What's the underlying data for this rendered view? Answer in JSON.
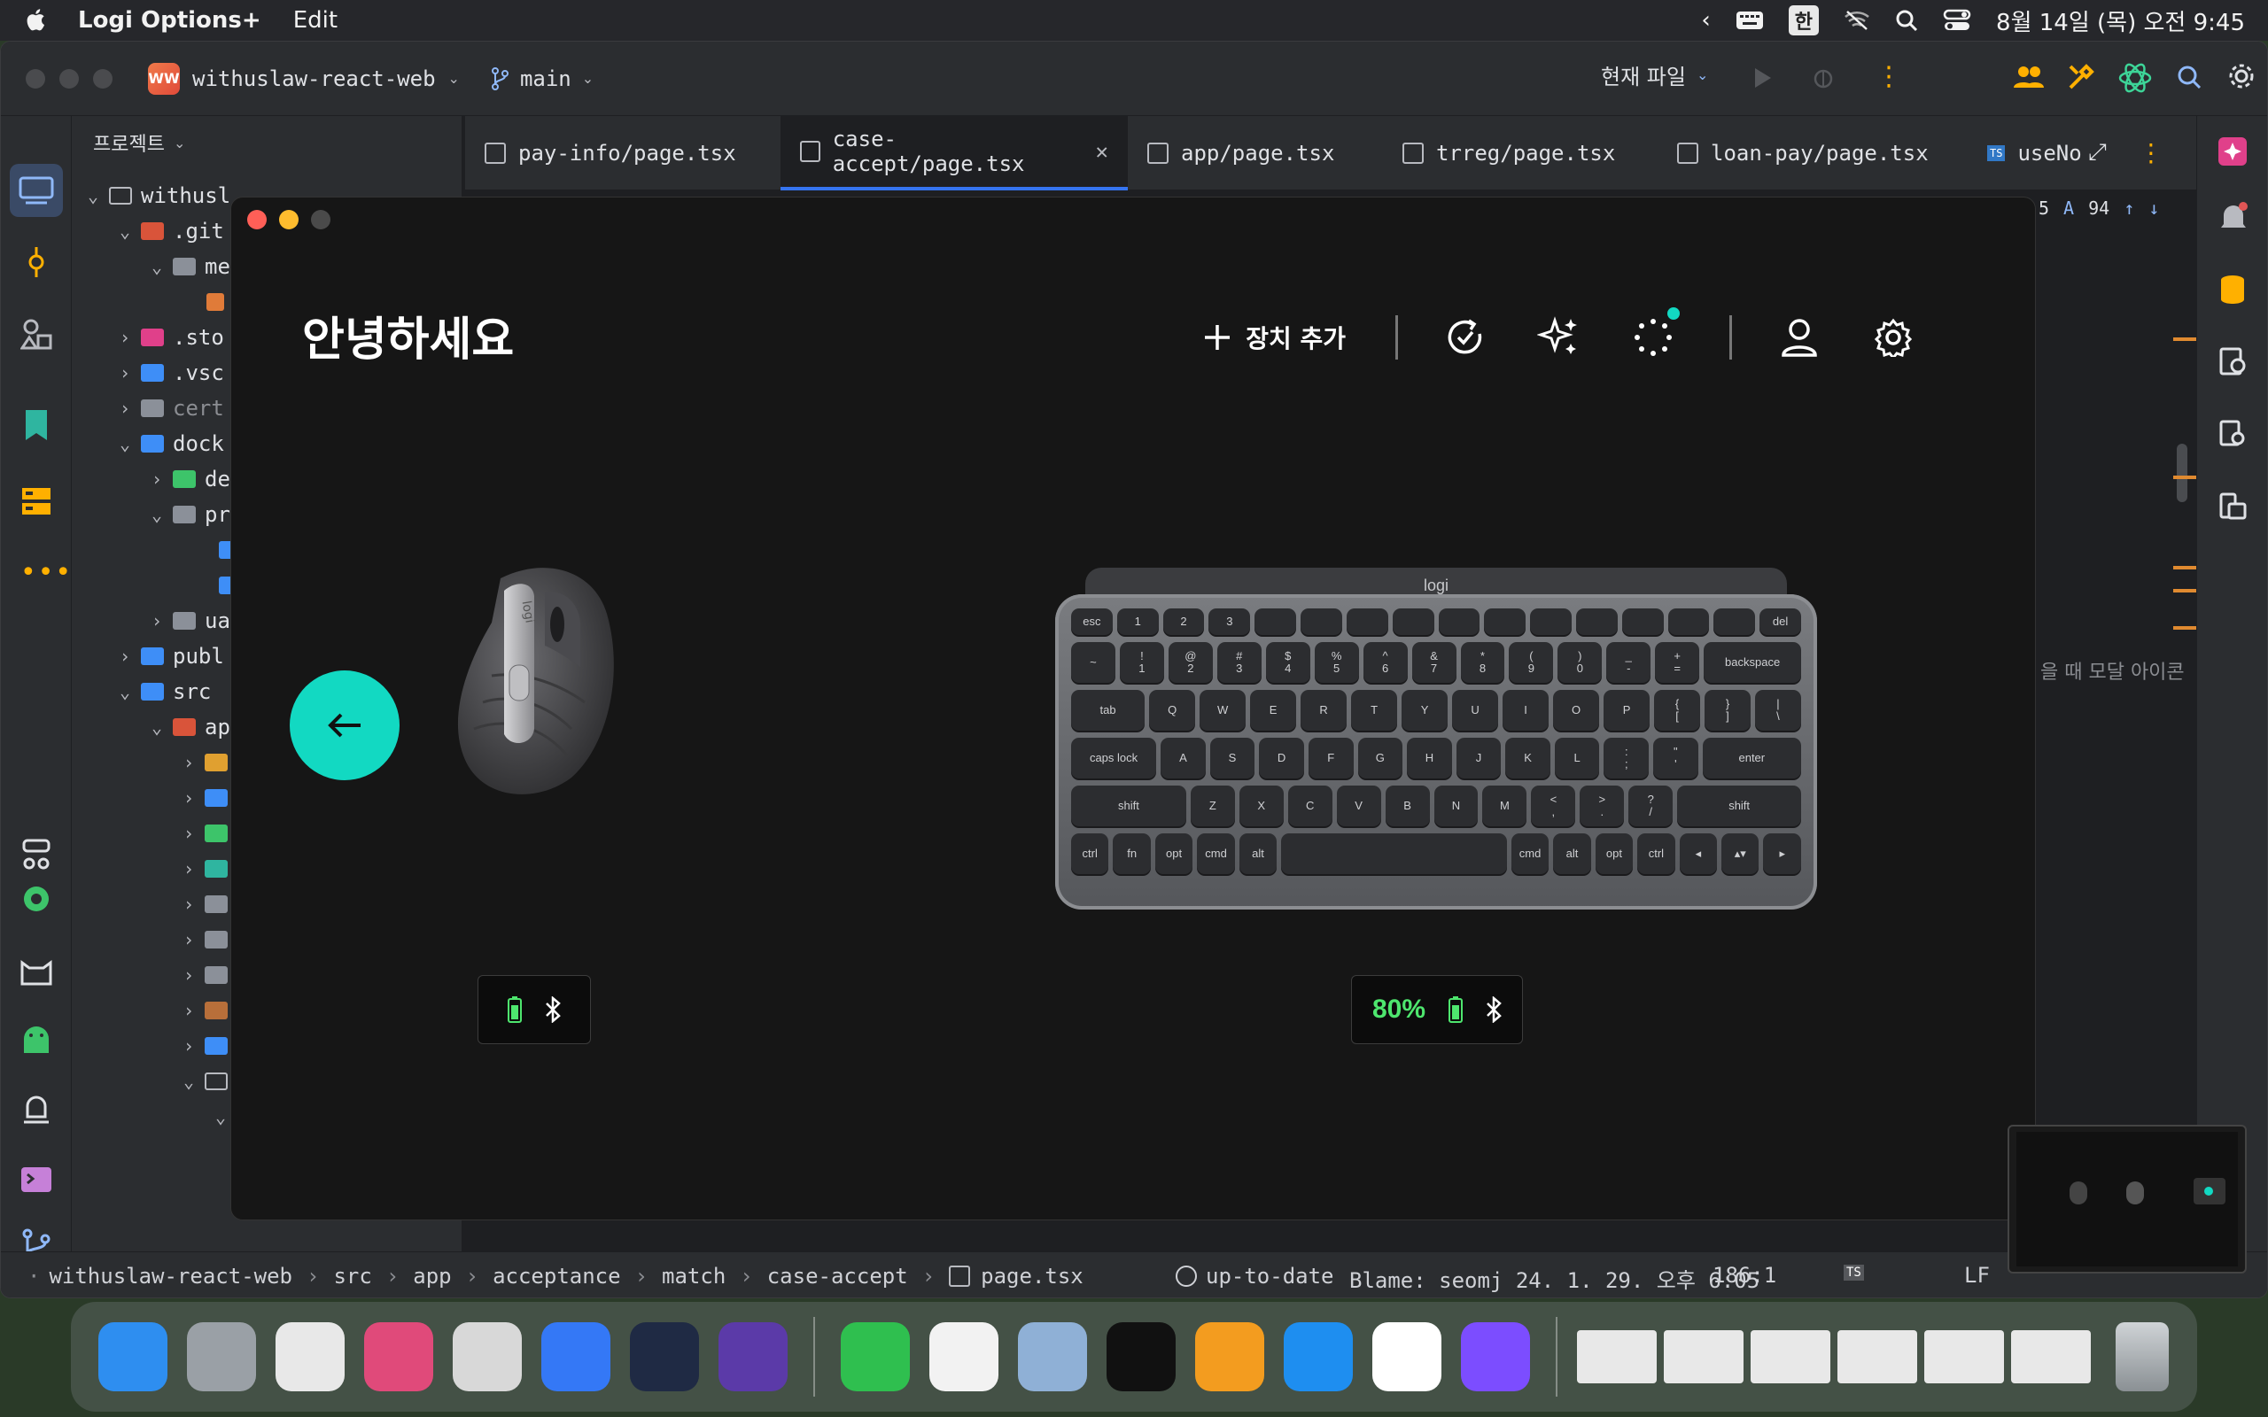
{
  "menubar": {
    "app_name": "Logi Options+",
    "menu_edit": "Edit",
    "ime_badge": "한",
    "datetime": "8월 14일 (목) 오전 9:45"
  },
  "ide": {
    "project_badge": "WW",
    "project_name": "withuslaw-react-web",
    "branch": "main",
    "run_config": "현재 파일",
    "panel_title": "프로젝트",
    "tabs": [
      {
        "label": "pay-info/page.tsx"
      },
      {
        "label": "case-accept/page.tsx"
      },
      {
        "label": "app/page.tsx"
      },
      {
        "label": "trreg/page.tsx"
      },
      {
        "label": "loan-pay/page.tsx"
      },
      {
        "label": "useNo"
      }
    ],
    "tree": {
      "root": "withusl",
      "git": ".git",
      "me": "me",
      "sto": ".sto",
      "vsc": ".vsc",
      "cert": "cert",
      "dock": "dock",
      "de": "de",
      "pr": "pr",
      "ua": "ua",
      "publ": "publ",
      "src": "src",
      "ap": "ap"
    },
    "editor_inspection": {
      "count_a": "5",
      "count_b": "94"
    },
    "editor_snippet": "을 때 모달 아이콘",
    "breadcrumb": [
      "withuslaw-react-web",
      "src",
      "app",
      "acceptance",
      "match",
      "case-accept",
      "page.tsx"
    ],
    "status": {
      "vcs": "up-to-date",
      "blame": "Blame: seomj 24. 1. 29. 오후 6:05",
      "position": "186:1",
      "line_ending": "LF"
    }
  },
  "logi": {
    "greeting": "안녕하세요",
    "add_device": "장치 추가",
    "keyboard_logo": "logi",
    "mouse_logo": "logi",
    "keyboard_battery": "80%",
    "accent_color": "#12d9c2",
    "battery_color": "#4ee66e",
    "keyboard_rows": [
      [
        "esc",
        "1",
        "2",
        "3",
        "",
        "",
        "",
        "",
        "",
        "",
        "",
        "",
        "",
        "",
        "",
        "del"
      ],
      [
        "~",
        "!\n1",
        "@\n2",
        "#\n3",
        "$\n4",
        "%\n5",
        "^\n6",
        "&\n7",
        "*\n8",
        "(\n9",
        ")\n0",
        "_\n-",
        "+\n=",
        "backspace"
      ],
      [
        "tab",
        "Q",
        "W",
        "E",
        "R",
        "T",
        "Y",
        "U",
        "I",
        "O",
        "P",
        "{\n[",
        "}\n]",
        "|\n\\"
      ],
      [
        "caps lock",
        "A",
        "S",
        "D",
        "F",
        "G",
        "H",
        "J",
        "K",
        "L",
        ":\n;",
        "\"\n'",
        "enter"
      ],
      [
        "shift",
        "Z",
        "X",
        "C",
        "V",
        "B",
        "N",
        "M",
        "<\n,",
        ">\n.",
        "?\n/",
        "shift"
      ],
      [
        "ctrl",
        "fn",
        "opt",
        "cmd",
        "alt",
        "",
        "cmd",
        "alt",
        "opt",
        "ctrl",
        "◂",
        "▴▾",
        "▸"
      ]
    ]
  },
  "dock": {
    "apps": [
      {
        "name": "finder",
        "color": "#2e8ef0"
      },
      {
        "name": "launchpad",
        "color": "#9aa0a6"
      },
      {
        "name": "chrome",
        "color": "#e8e8e8"
      },
      {
        "name": "intellij",
        "color": "#e04a7a"
      },
      {
        "name": "tableplus",
        "color": "#d8d8d8"
      },
      {
        "name": "notes",
        "color": "#3478f6"
      },
      {
        "name": "vscode-like",
        "color": "#1f2a44"
      },
      {
        "name": "obsidian",
        "color": "#5b3aa8"
      },
      {
        "name": "numbers",
        "color": "#2fbf4f"
      },
      {
        "name": "naver-works",
        "color": "#f2f2f2"
      },
      {
        "name": "preview",
        "color": "#8fb0d6"
      },
      {
        "name": "terminal",
        "color": "#111111"
      },
      {
        "name": "pages",
        "color": "#f39c1f"
      },
      {
        "name": "keynote",
        "color": "#1e8ef0"
      },
      {
        "name": "naver-cube",
        "color": "#ffffff"
      },
      {
        "name": "logi-options",
        "color": "#7c4dff"
      }
    ]
  }
}
